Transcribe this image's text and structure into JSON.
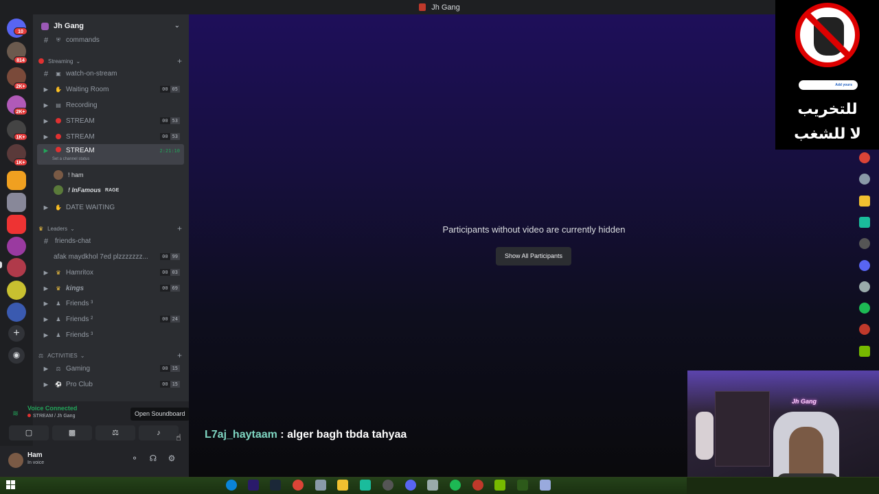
{
  "window": {
    "title": "Jh Gang"
  },
  "rail": {
    "home_badge": "10",
    "badges": [
      "814",
      "2K+",
      "2K+",
      "1K+",
      "1K+"
    ]
  },
  "server": {
    "name": "Jh Gang"
  },
  "channels": {
    "commands": "commands",
    "cat_streaming": "Streaming",
    "watch_on_stream": "watch-on-stream",
    "waiting_room": "Waiting Room",
    "waiting_room_counts": [
      "00",
      "05"
    ],
    "recording": "Recording",
    "stream1": "STREAM",
    "stream1_counts": [
      "00",
      "53"
    ],
    "stream2": "STREAM",
    "stream2_counts": [
      "00",
      "53"
    ],
    "stream3": "STREAM",
    "stream3_timer": "2:21:10",
    "set_status": "Set a channel status",
    "user1": "! ham",
    "user2": "! InFamous",
    "user2_tag": "RAGE",
    "date_waiting": "DATE WAITING",
    "cat_leaders": "Leaders",
    "friends_chat": "friends-chat",
    "afak": "afak maydkhol 7ed plzzzzzzz...",
    "afak_counts": [
      "00",
      "99"
    ],
    "hamritox": "Hamritox",
    "hamritox_counts": [
      "00",
      "03"
    ],
    "kings": "kings",
    "kings_counts": [
      "00",
      "69"
    ],
    "friends3a": "Friends ³",
    "friends2": "Friends ²",
    "friends2_counts": [
      "00",
      "24"
    ],
    "friends3b": "Friends ³",
    "cat_activities": "ACTIVITIES",
    "gaming": "Gaming",
    "gaming_counts": [
      "00",
      "15"
    ],
    "pro_club": "Pro Club",
    "pro_club_counts": [
      "00",
      "15"
    ]
  },
  "voice": {
    "status": "Voice Connected",
    "location": "STREAM / Jh Gang",
    "tooltip": "Open Soundboard"
  },
  "user": {
    "name": "Ham",
    "status": "In voice"
  },
  "main": {
    "hidden_message": "Participants without video are currently hidden",
    "show_button": "Show All Participants"
  },
  "chat": {
    "author": "L7aj_haytaam",
    "separator": " : ",
    "message": "alger bagh tbda tahyaa"
  },
  "overlay": {
    "pill": "Add yours",
    "arabic_line1": "للتخريب",
    "arabic_line2": "لا للشغب",
    "webcam_sign": "Jh Gang"
  },
  "colors": {
    "accent_green": "#23a55a",
    "live_red": "#e03131",
    "chat_author": "#7fd6c2"
  }
}
